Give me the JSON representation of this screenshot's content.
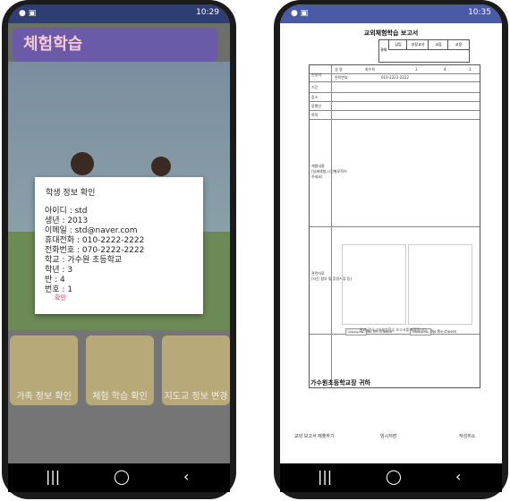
{
  "left": {
    "status_time": "10:29",
    "app_title": "체험학습",
    "menu": [
      "가족 정보 확인",
      "체험 학습 확인",
      "지도교 정보 변경"
    ],
    "dialog": {
      "title": "학생 정보 확인",
      "lines": [
        "아이디 : std",
        "생년 : 2013",
        "이메일 : std@naver.com",
        "휴대전화 : 010-2222-2222",
        "전화번호 : 070-2222-2222",
        "학교 : 가수원 초등학교",
        "학년 : 3",
        "반 : 4",
        "번호 : 1"
      ],
      "ok": "확인"
    }
  },
  "right": {
    "status_time": "10:35",
    "doc_title": "교외체험학습 보고서",
    "approval_labels": [
      "결재",
      "담임",
      "부장교사",
      "교감",
      "교장"
    ],
    "form_labels": {
      "applicant": "신청자",
      "name": "성 명",
      "name_value": "최수희",
      "grade": "3",
      "class": "4",
      "number": "1",
      "contact": "연락번호",
      "contact_value": "010-2222-2222",
      "period": "기간",
      "place": "장소",
      "companion": "동행인",
      "purpose": "목적",
      "activity": "체험내용\n(실제체험,시간별로적어\n주세요)",
      "photo": "관련자료\n(사진 첨부 및 증빙서류 등)"
    },
    "file_button": "Choose File",
    "file_status": "No file chosen",
    "statement": "위와 같이 교외체험학습 보고서를 제출합니다.",
    "principal": "가수원초등학교장 귀하",
    "buttons": [
      "교외 보고서 제출하기",
      "임시저장",
      "작성취소"
    ]
  }
}
